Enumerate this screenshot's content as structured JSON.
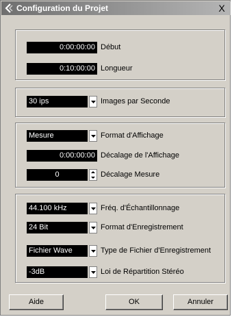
{
  "window": {
    "title": "Configuration du Projet",
    "close_glyph": "X"
  },
  "time_group": {
    "start_value": "0:00:00:00",
    "start_label": "Début",
    "length_value": "0:10:00:00",
    "length_label": "Longueur"
  },
  "fps_group": {
    "value": "30 ips",
    "label": "Images par Seconde"
  },
  "display_group": {
    "format_value": "Mesure",
    "format_label": "Format d'Affichage",
    "offset_value": "0:00:00:00",
    "offset_label": "Décalage de l'Affichage",
    "bar_offset_value": "0",
    "bar_offset_label": "Décalage Mesure"
  },
  "recording_group": {
    "sample_rate_value": "44.100 kHz",
    "sample_rate_label": "Fréq. d'Échantillonnage",
    "record_format_value": "24 Bit",
    "record_format_label": "Format d'Enregistrement",
    "file_type_value": "Fichier Wave",
    "file_type_label": "Type de Fichier d'Enregistrement",
    "pan_law_value": "-3dB",
    "pan_law_label": "Loi de Répartition Stéréo"
  },
  "buttons": {
    "help": "Aide",
    "ok": "OK",
    "cancel": "Annuler"
  }
}
